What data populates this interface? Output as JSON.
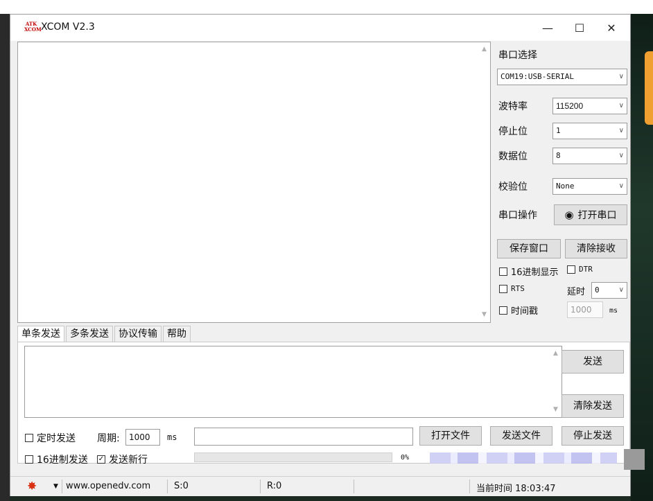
{
  "window": {
    "logo_text": "ATK\nXCOM",
    "title": "XCOM V2.3",
    "controls": {
      "minimize": "—",
      "maximize": "☐",
      "close": "✕"
    }
  },
  "port_settings": {
    "port_select_label": "串口选择",
    "port_value": "COM19:USB-SERIAL",
    "baud_label": "波特率",
    "baud_value": "115200",
    "stopbits_label": "停止位",
    "stopbits_value": "1",
    "databits_label": "数据位",
    "databits_value": "8",
    "parity_label": "校验位",
    "parity_value": "None",
    "port_op_label": "串口操作",
    "open_port_button": "打开串口"
  },
  "receive_controls": {
    "save_window_button": "保存窗口",
    "clear_receive_button": "清除接收",
    "hex_display_label": "16进制显示",
    "hex_display_checked": false,
    "dtr_label": "DTR",
    "dtr_checked": false,
    "rts_label": "RTS",
    "rts_checked": false,
    "delay_label": "延时",
    "delay_value": "0",
    "timestamp_label": "时间戳",
    "timestamp_checked": false,
    "timestamp_value": "1000",
    "timestamp_unit": "ms"
  },
  "tabs": [
    "单条发送",
    "多条发送",
    "协议传输",
    "帮助"
  ],
  "send": {
    "send_button": "发送",
    "clear_send_button": "清除发送",
    "timed_send_label": "定时发送",
    "timed_send_checked": false,
    "period_label": "周期:",
    "period_value": "1000",
    "period_unit": "ms",
    "file_path_value": "",
    "open_file_button": "打开文件",
    "send_file_button": "发送文件",
    "stop_send_button": "停止发送",
    "hex_send_label": "16进制发送",
    "hex_send_checked": false,
    "newline_label": "发送新行",
    "newline_checked": true,
    "progress_percent_text": "0%",
    "progress_fraction": 0
  },
  "statusbar": {
    "website": "www.openedv.com",
    "sent": "S:0",
    "received": "R:0",
    "clock": "当前时间 18:03:47"
  },
  "icons": {
    "gear": "gear-icon",
    "radio": "radio-icon",
    "chevron": "chevron-down-icon"
  },
  "colors": {
    "progress": "#06b025",
    "gear": "#d83010",
    "logo": "#c00000"
  }
}
